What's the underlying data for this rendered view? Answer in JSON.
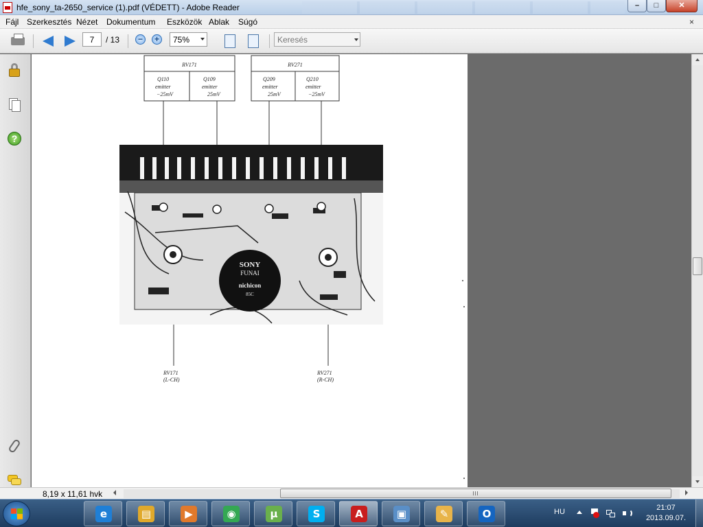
{
  "window": {
    "title": "hfe_sony_ta-2650_service (1).pdf (VÉDETT) - Adobe Reader",
    "minimize_label": "–",
    "maximize_label": "□",
    "close_label": "✕"
  },
  "menu": {
    "items": [
      "Fájl",
      "Szerkesztés",
      "Nézet",
      "Dokumentum",
      "Eszközök",
      "Ablak",
      "Súgó"
    ],
    "close_doc_label": "×"
  },
  "toolbar": {
    "current_page": "7",
    "total_pages": "/ 13",
    "zoom_out_label": "−",
    "zoom_in_label": "+",
    "zoom": "75%",
    "search_placeholder": "Keresés"
  },
  "document": {
    "left_box": {
      "title": "RV171",
      "cells": [
        {
          "name": "Q110",
          "line2": "emitter",
          "line3": "−25mV"
        },
        {
          "name": "Q109",
          "line2": "emitter",
          "line3": "25mV"
        }
      ]
    },
    "right_box": {
      "title": "RV271",
      "cells": [
        {
          "name": "Q209",
          "line2": "emitter",
          "line3": "25mV"
        },
        {
          "name": "Q210",
          "line2": "emitter",
          "line3": "−25mV"
        }
      ]
    },
    "bottom_left_label": {
      "line1": "RV171",
      "line2": "(L-CH)"
    },
    "bottom_right_label": {
      "line1": "RV271",
      "line2": "(R-CH)"
    },
    "capacitor_text": [
      "SONY",
      "FUNAI",
      "nichicon",
      "85C"
    ]
  },
  "status": {
    "page_size": "8,19 x 11,61 hvk"
  },
  "taskbar": {
    "apps": [
      {
        "name": "internet-explorer",
        "glyph": "e",
        "color": "#1f7fd6"
      },
      {
        "name": "file-explorer",
        "glyph": "▤",
        "color": "#e0a92b"
      },
      {
        "name": "media-player",
        "glyph": "▶",
        "color": "#e0792b"
      },
      {
        "name": "chrome",
        "glyph": "◉",
        "color": "#34a853"
      },
      {
        "name": "utorrent",
        "glyph": "µ",
        "color": "#6ab04c"
      },
      {
        "name": "skype",
        "glyph": "S",
        "color": "#00aff0"
      },
      {
        "name": "adobe-reader",
        "glyph": "A",
        "color": "#c81e1e"
      },
      {
        "name": "photo-viewer",
        "glyph": "▣",
        "color": "#5a8fc7"
      },
      {
        "name": "paint",
        "glyph": "✎",
        "color": "#e8b44a"
      },
      {
        "name": "outlook",
        "glyph": "O",
        "color": "#1565c0"
      }
    ],
    "active_app": "adobe-reader",
    "language": "HU",
    "time": "21:07",
    "date": "2013.09.07."
  }
}
